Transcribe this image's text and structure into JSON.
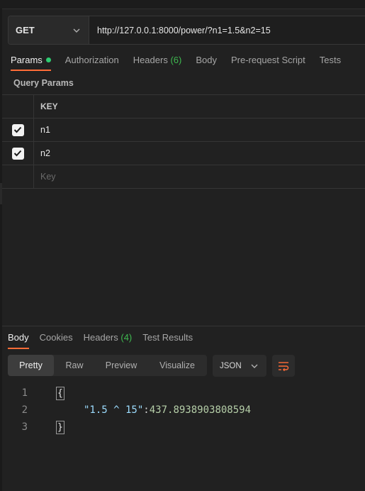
{
  "request": {
    "method": "GET",
    "url": "http://127.0.0.1:8000/power/?n1=1.5&n2=15"
  },
  "request_tabs": [
    {
      "label": "Params",
      "count": "",
      "active": true,
      "dot": true
    },
    {
      "label": "Authorization",
      "count": ""
    },
    {
      "label": "Headers",
      "count": "(6)"
    },
    {
      "label": "Body",
      "count": ""
    },
    {
      "label": "Pre-request Script",
      "count": ""
    },
    {
      "label": "Tests",
      "count": ""
    }
  ],
  "query_params": {
    "section_label": "Query Params",
    "column_key": "KEY",
    "rows": [
      {
        "key": "n1",
        "checked": true
      },
      {
        "key": "n2",
        "checked": true
      }
    ],
    "new_key_placeholder": "Key"
  },
  "response_tabs": [
    {
      "label": "Body",
      "count": "",
      "active": true
    },
    {
      "label": "Cookies",
      "count": ""
    },
    {
      "label": "Headers",
      "count": "(4)"
    },
    {
      "label": "Test Results",
      "count": ""
    }
  ],
  "format_buttons": [
    "Pretty",
    "Raw",
    "Preview",
    "Visualize"
  ],
  "format_active": "Pretty",
  "language": "JSON",
  "response_body": {
    "line_numbers": [
      "1",
      "2",
      "3"
    ],
    "open_brace": "{",
    "close_brace": "}",
    "key": "\"1.5 ^ 15\"",
    "colon": ": ",
    "value": "437.8938903808594"
  },
  "colors": {
    "accent": "#ff6c37",
    "count_green": "#3fb950",
    "json_key": "#9cdcfe",
    "json_number": "#b5cea8"
  }
}
